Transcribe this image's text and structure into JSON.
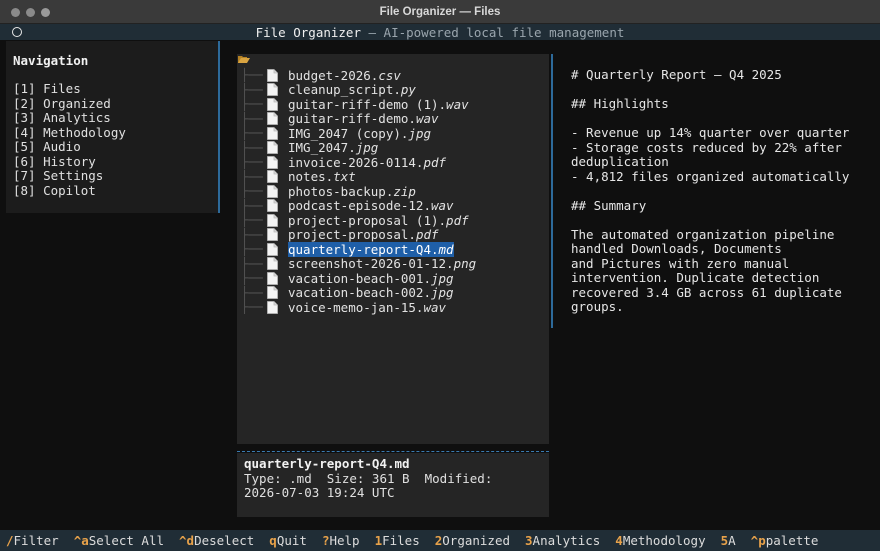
{
  "window": {
    "title": "File Organizer — Files"
  },
  "header": {
    "title": "File Organizer",
    "separator": " — ",
    "subtitle": "AI-powered local file management"
  },
  "sidebar": {
    "title": "Navigation",
    "items": [
      {
        "label": "[1] Files"
      },
      {
        "label": "[2] Organized"
      },
      {
        "label": "[3] Analytics"
      },
      {
        "label": "[4] Methodology"
      },
      {
        "label": "[5] Audio"
      },
      {
        "label": "[6] History"
      },
      {
        "label": "[7] Settings"
      },
      {
        "label": "[8] Copilot"
      }
    ]
  },
  "tree": {
    "folder_icon": "open-folder-icon",
    "selected_index": 12,
    "files": [
      {
        "stem": "budget-2026.",
        "ext": "csv"
      },
      {
        "stem": "cleanup_script.",
        "ext": "py"
      },
      {
        "stem": "guitar-riff-demo (1).",
        "ext": "wav"
      },
      {
        "stem": "guitar-riff-demo.",
        "ext": "wav"
      },
      {
        "stem": "IMG_2047 (copy).",
        "ext": "jpg"
      },
      {
        "stem": "IMG_2047.",
        "ext": "jpg"
      },
      {
        "stem": "invoice-2026-0114.",
        "ext": "pdf"
      },
      {
        "stem": "notes.",
        "ext": "txt"
      },
      {
        "stem": "photos-backup.",
        "ext": "zip"
      },
      {
        "stem": "podcast-episode-12.",
        "ext": "wav"
      },
      {
        "stem": "project-proposal (1).",
        "ext": "pdf"
      },
      {
        "stem": "project-proposal.",
        "ext": "pdf"
      },
      {
        "stem": "quarterly-report-Q4.",
        "ext": "md"
      },
      {
        "stem": "screenshot-2026-01-12.",
        "ext": "png"
      },
      {
        "stem": "vacation-beach-001.",
        "ext": "jpg"
      },
      {
        "stem": "vacation-beach-002.",
        "ext": "jpg"
      },
      {
        "stem": "voice-memo-jan-15.",
        "ext": "wav"
      }
    ]
  },
  "detail": {
    "name": "quarterly-report-Q4.md",
    "line1": "Type: .md  Size: 361 B  Modified:",
    "line2": "2026-07-03 19:24 UTC"
  },
  "preview": {
    "lines": [
      "# Quarterly Report — Q4 2025",
      "",
      "## Highlights",
      "",
      "- Revenue up 14% quarter over quarter",
      "- Storage costs reduced by 22% after",
      "deduplication",
      "- 4,812 files organized automatically",
      "",
      "## Summary",
      "",
      "The automated organization pipeline",
      "handled Downloads, Documents",
      "and Pictures with zero manual",
      "intervention. Duplicate detection",
      "recovered 3.4 GB across 61 duplicate",
      "groups."
    ]
  },
  "footer": {
    "bindings": [
      {
        "key": "/",
        "label": "Filter"
      },
      {
        "key": "^a",
        "label": "Select All"
      },
      {
        "key": "^d",
        "label": "Deselect"
      },
      {
        "key": "q",
        "label": "Quit"
      },
      {
        "key": "?",
        "label": "Help"
      },
      {
        "key": "1",
        "label": "Files"
      },
      {
        "key": "2",
        "label": "Organized"
      },
      {
        "key": "3",
        "label": "Analytics"
      },
      {
        "key": "4",
        "label": "Methodology"
      },
      {
        "key": "5",
        "label": "A"
      },
      {
        "key": "^p",
        "label": "palette"
      }
    ]
  },
  "colors": {
    "accent": "#2d6a9a",
    "selection": "#1f5fa8",
    "key": "#e8a24a",
    "header_bg": "#202d36"
  }
}
